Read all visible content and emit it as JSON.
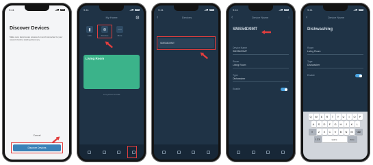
{
  "colors": {
    "accent_red": "#e23e3e",
    "app_bg": "#1f3346",
    "primary_blue": "#3a82b8",
    "room_green": "#3bb38a"
  },
  "status_time": "9:41",
  "phone1": {
    "title": "Discover Devices",
    "description": "Make sure devices are powered on and connected to your network before starting discovery.",
    "cancel_label": "Cancel",
    "discover_label": "Discover Devices"
  },
  "phone2": {
    "header": "My Home",
    "hubs": [
      "Hub",
      "Devices",
      "More"
    ],
    "room_title": "Living Room",
    "manage_text": "Long Press to Add",
    "tabs": [
      "Home",
      "Scenes",
      "Automations",
      "Devices"
    ]
  },
  "phone3": {
    "header": "Devices",
    "device_name": "SMS54D9MT"
  },
  "phone4": {
    "header": "Device Name",
    "device_name": "SMS54D9MT",
    "fields": [
      {
        "label": "Device Name",
        "value": "SMS54D9MT"
      },
      {
        "label": "Room",
        "value": "Living Room"
      },
      {
        "label": "Type",
        "value": "Dishwasher"
      },
      {
        "label": "Enable",
        "value": ""
      }
    ]
  },
  "phone5": {
    "header": "Device Name",
    "device_name": "Dishwashing",
    "fields": [
      {
        "label": "Room",
        "value": "Living Room"
      },
      {
        "label": "Type",
        "value": "Dishwasher"
      },
      {
        "label": "Enable",
        "value": ""
      }
    ],
    "keyboard_rows": [
      [
        "Q",
        "W",
        "E",
        "R",
        "T",
        "Y",
        "U",
        "I",
        "O",
        "P"
      ],
      [
        "A",
        "S",
        "D",
        "F",
        "G",
        "H",
        "J",
        "K",
        "L"
      ],
      [
        "Z",
        "X",
        "C",
        "V",
        "B",
        "N",
        "M"
      ]
    ],
    "space_label": "space",
    "return_label": "done"
  }
}
